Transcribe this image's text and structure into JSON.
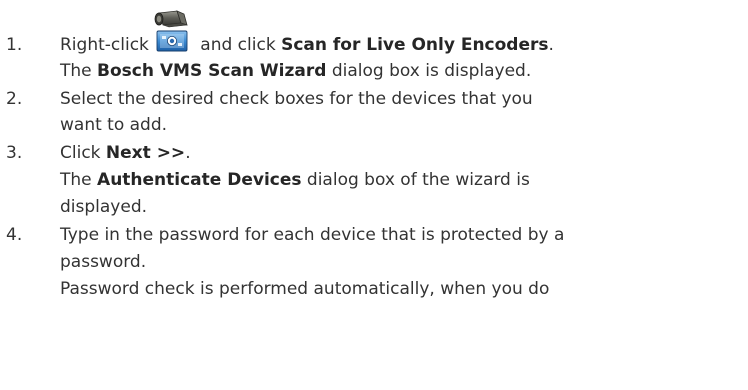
{
  "steps": [
    {
      "number": "1.",
      "line1": {
        "pre": "Right-click",
        "icon": "camera-encoder-icon",
        "mid": " and click ",
        "bold": "Scan for Live Only Encoders",
        "post": "."
      },
      "line2": {
        "pre": "The ",
        "bold": "Bosch VMS Scan Wizard",
        "post": " dialog box is displayed."
      }
    },
    {
      "number": "2.",
      "line1": "Select the desired check boxes for the devices that you",
      "line2": "want to add."
    },
    {
      "number": "3.",
      "line1": {
        "pre": "Click ",
        "bold": "Next >>",
        "post": "."
      },
      "line2": {
        "pre": "The ",
        "bold": "Authenticate Devices",
        "post": " dialog box of the wizard is"
      },
      "line3": "displayed."
    },
    {
      "number": "4.",
      "line1": "Type in the password for each device that is protected by a",
      "line2": "password.",
      "line3": "Password check is performed automatically, when you do"
    }
  ]
}
